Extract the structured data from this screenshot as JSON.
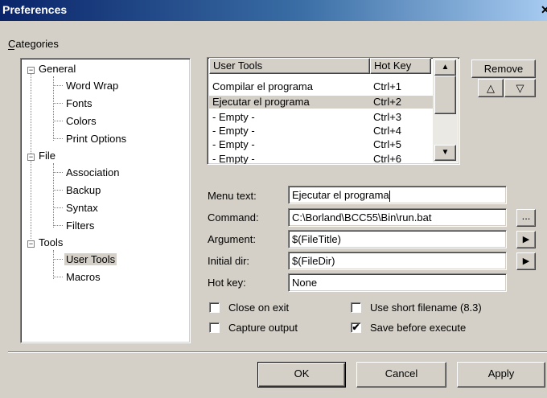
{
  "window": {
    "title": "Preferences",
    "close_glyph": "✕"
  },
  "categories_label": "Categories",
  "tree": {
    "general": "General",
    "word_wrap": "Word Wrap",
    "fonts": "Fonts",
    "colors": "Colors",
    "print_options": "Print Options",
    "file": "File",
    "association": "Association",
    "backup": "Backup",
    "syntax": "Syntax",
    "filters": "Filters",
    "tools": "Tools",
    "user_tools": "User Tools",
    "macros": "Macros",
    "expanded_glyph": "−"
  },
  "list": {
    "col1": "User Tools",
    "col2": "Hot Key",
    "rows": [
      {
        "name": "Compilar el programa",
        "key": "Ctrl+1"
      },
      {
        "name": "Ejecutar el programa",
        "key": "Ctrl+2"
      },
      {
        "name": "- Empty -",
        "key": "Ctrl+3"
      },
      {
        "name": "- Empty -",
        "key": "Ctrl+4"
      },
      {
        "name": "- Empty -",
        "key": "Ctrl+5"
      },
      {
        "name": "- Empty -",
        "key": "Ctrl+6"
      }
    ]
  },
  "buttons": {
    "remove": "Remove",
    "up": "△",
    "down": "▽",
    "ok": "OK",
    "cancel": "Cancel",
    "apply": "Apply",
    "browse": "...",
    "arrow": "▶"
  },
  "form": {
    "menu_text_label": "Menu text:",
    "menu_text_value": "Ejecutar el programa",
    "command_label": "Command:",
    "command_value": "C:\\Borland\\BCC55\\Bin\\run.bat",
    "argument_label": "Argument:",
    "argument_value": "$(FileTitle)",
    "initial_dir_label": "Initial dir:",
    "initial_dir_value": "$(FileDir)",
    "hot_key_label": "Hot key:",
    "hot_key_value": "None"
  },
  "options": {
    "close_on_exit": {
      "label": "Close on exit",
      "checked": false
    },
    "capture_output": {
      "label": "Capture output",
      "checked": false
    },
    "use_short_filename": {
      "label": "Use short filename (8.3)",
      "checked": false
    },
    "save_before_execute": {
      "label": "Save before execute",
      "checked": true
    },
    "check_glyph": "✔"
  }
}
